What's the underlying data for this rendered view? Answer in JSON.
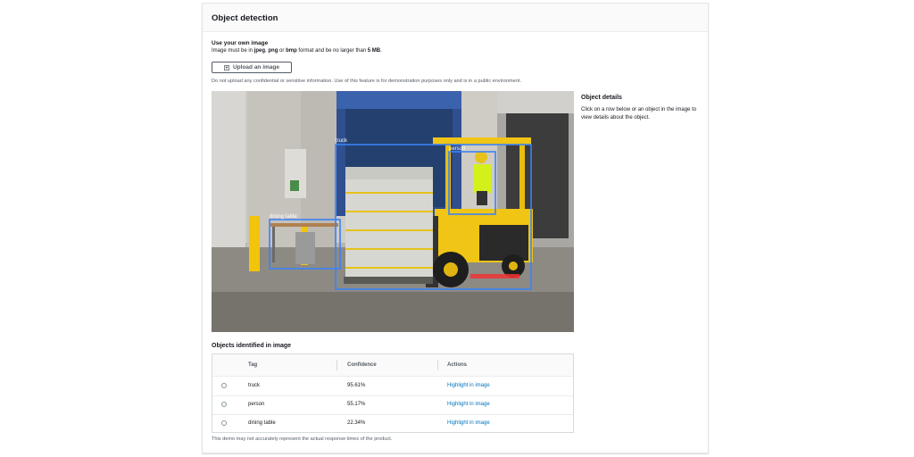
{
  "panel": {
    "title": "Object detection"
  },
  "upload": {
    "title": "Use your own image",
    "desc_prefix": "Image must be in ",
    "fmt1": "jpeg",
    "sep1": ", ",
    "fmt2": "png",
    "sep2": " or ",
    "fmt3": "bmp",
    "desc_middle": " format and be no larger than ",
    "max_size": "5 MB",
    "desc_suffix": ".",
    "button_label": "Upload an image",
    "disclaimer": "Do not upload any confidential or sensitive information. Use of this feature is for demonstration purposes only and is in a public environment."
  },
  "image": {
    "icon": "upload-icon",
    "box_color": "#3b82f6",
    "labels": {
      "truck": "truck",
      "person": "person",
      "dining_table": "dining table"
    }
  },
  "details": {
    "title": "Object details",
    "desc": "Click on a row below or an object in the image to view details about the object."
  },
  "objects": {
    "title": "Objects identified in image",
    "headers": {
      "tag": "Tag",
      "confidence": "Confidence",
      "actions": "Actions"
    },
    "rows": [
      {
        "tag": "truck",
        "confidence": "95.61%",
        "action": "Highlight in image"
      },
      {
        "tag": "person",
        "confidence": "55.17%",
        "action": "Highlight in image"
      },
      {
        "tag": "dining table",
        "confidence": "22.34%",
        "action": "Highlight in image"
      }
    ]
  },
  "footer": {
    "note": "This demo may not accurately represent the actual response times of the product."
  },
  "colors": {
    "link": "#0073bb",
    "border": "#d5dbdb",
    "text": "#16191f",
    "muted": "#545b64"
  }
}
